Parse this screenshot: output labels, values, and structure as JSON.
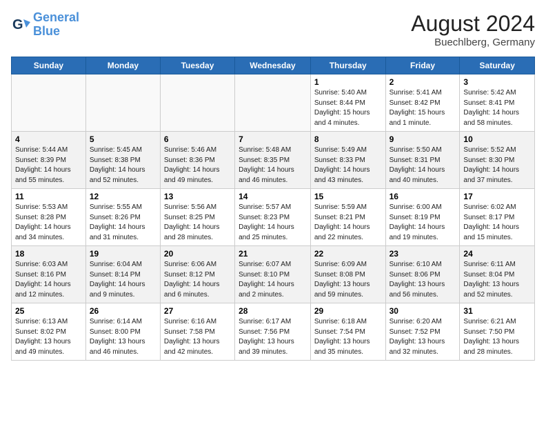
{
  "header": {
    "logo_line1": "General",
    "logo_line2": "Blue",
    "month_year": "August 2024",
    "location": "Buechlberg, Germany"
  },
  "weekdays": [
    "Sunday",
    "Monday",
    "Tuesday",
    "Wednesday",
    "Thursday",
    "Friday",
    "Saturday"
  ],
  "weeks": [
    [
      {
        "day": "",
        "info": "",
        "empty": true
      },
      {
        "day": "",
        "info": "",
        "empty": true
      },
      {
        "day": "",
        "info": "",
        "empty": true
      },
      {
        "day": "",
        "info": "",
        "empty": true
      },
      {
        "day": "1",
        "info": "Sunrise: 5:40 AM\nSunset: 8:44 PM\nDaylight: 15 hours\nand 4 minutes.",
        "empty": false
      },
      {
        "day": "2",
        "info": "Sunrise: 5:41 AM\nSunset: 8:42 PM\nDaylight: 15 hours\nand 1 minute.",
        "empty": false
      },
      {
        "day": "3",
        "info": "Sunrise: 5:42 AM\nSunset: 8:41 PM\nDaylight: 14 hours\nand 58 minutes.",
        "empty": false
      }
    ],
    [
      {
        "day": "4",
        "info": "Sunrise: 5:44 AM\nSunset: 8:39 PM\nDaylight: 14 hours\nand 55 minutes.",
        "empty": false
      },
      {
        "day": "5",
        "info": "Sunrise: 5:45 AM\nSunset: 8:38 PM\nDaylight: 14 hours\nand 52 minutes.",
        "empty": false
      },
      {
        "day": "6",
        "info": "Sunrise: 5:46 AM\nSunset: 8:36 PM\nDaylight: 14 hours\nand 49 minutes.",
        "empty": false
      },
      {
        "day": "7",
        "info": "Sunrise: 5:48 AM\nSunset: 8:35 PM\nDaylight: 14 hours\nand 46 minutes.",
        "empty": false
      },
      {
        "day": "8",
        "info": "Sunrise: 5:49 AM\nSunset: 8:33 PM\nDaylight: 14 hours\nand 43 minutes.",
        "empty": false
      },
      {
        "day": "9",
        "info": "Sunrise: 5:50 AM\nSunset: 8:31 PM\nDaylight: 14 hours\nand 40 minutes.",
        "empty": false
      },
      {
        "day": "10",
        "info": "Sunrise: 5:52 AM\nSunset: 8:30 PM\nDaylight: 14 hours\nand 37 minutes.",
        "empty": false
      }
    ],
    [
      {
        "day": "11",
        "info": "Sunrise: 5:53 AM\nSunset: 8:28 PM\nDaylight: 14 hours\nand 34 minutes.",
        "empty": false
      },
      {
        "day": "12",
        "info": "Sunrise: 5:55 AM\nSunset: 8:26 PM\nDaylight: 14 hours\nand 31 minutes.",
        "empty": false
      },
      {
        "day": "13",
        "info": "Sunrise: 5:56 AM\nSunset: 8:25 PM\nDaylight: 14 hours\nand 28 minutes.",
        "empty": false
      },
      {
        "day": "14",
        "info": "Sunrise: 5:57 AM\nSunset: 8:23 PM\nDaylight: 14 hours\nand 25 minutes.",
        "empty": false
      },
      {
        "day": "15",
        "info": "Sunrise: 5:59 AM\nSunset: 8:21 PM\nDaylight: 14 hours\nand 22 minutes.",
        "empty": false
      },
      {
        "day": "16",
        "info": "Sunrise: 6:00 AM\nSunset: 8:19 PM\nDaylight: 14 hours\nand 19 minutes.",
        "empty": false
      },
      {
        "day": "17",
        "info": "Sunrise: 6:02 AM\nSunset: 8:17 PM\nDaylight: 14 hours\nand 15 minutes.",
        "empty": false
      }
    ],
    [
      {
        "day": "18",
        "info": "Sunrise: 6:03 AM\nSunset: 8:16 PM\nDaylight: 14 hours\nand 12 minutes.",
        "empty": false
      },
      {
        "day": "19",
        "info": "Sunrise: 6:04 AM\nSunset: 8:14 PM\nDaylight: 14 hours\nand 9 minutes.",
        "empty": false
      },
      {
        "day": "20",
        "info": "Sunrise: 6:06 AM\nSunset: 8:12 PM\nDaylight: 14 hours\nand 6 minutes.",
        "empty": false
      },
      {
        "day": "21",
        "info": "Sunrise: 6:07 AM\nSunset: 8:10 PM\nDaylight: 14 hours\nand 2 minutes.",
        "empty": false
      },
      {
        "day": "22",
        "info": "Sunrise: 6:09 AM\nSunset: 8:08 PM\nDaylight: 13 hours\nand 59 minutes.",
        "empty": false
      },
      {
        "day": "23",
        "info": "Sunrise: 6:10 AM\nSunset: 8:06 PM\nDaylight: 13 hours\nand 56 minutes.",
        "empty": false
      },
      {
        "day": "24",
        "info": "Sunrise: 6:11 AM\nSunset: 8:04 PM\nDaylight: 13 hours\nand 52 minutes.",
        "empty": false
      }
    ],
    [
      {
        "day": "25",
        "info": "Sunrise: 6:13 AM\nSunset: 8:02 PM\nDaylight: 13 hours\nand 49 minutes.",
        "empty": false
      },
      {
        "day": "26",
        "info": "Sunrise: 6:14 AM\nSunset: 8:00 PM\nDaylight: 13 hours\nand 46 minutes.",
        "empty": false
      },
      {
        "day": "27",
        "info": "Sunrise: 6:16 AM\nSunset: 7:58 PM\nDaylight: 13 hours\nand 42 minutes.",
        "empty": false
      },
      {
        "day": "28",
        "info": "Sunrise: 6:17 AM\nSunset: 7:56 PM\nDaylight: 13 hours\nand 39 minutes.",
        "empty": false
      },
      {
        "day": "29",
        "info": "Sunrise: 6:18 AM\nSunset: 7:54 PM\nDaylight: 13 hours\nand 35 minutes.",
        "empty": false
      },
      {
        "day": "30",
        "info": "Sunrise: 6:20 AM\nSunset: 7:52 PM\nDaylight: 13 hours\nand 32 minutes.",
        "empty": false
      },
      {
        "day": "31",
        "info": "Sunrise: 6:21 AM\nSunset: 7:50 PM\nDaylight: 13 hours\nand 28 minutes.",
        "empty": false
      }
    ]
  ]
}
